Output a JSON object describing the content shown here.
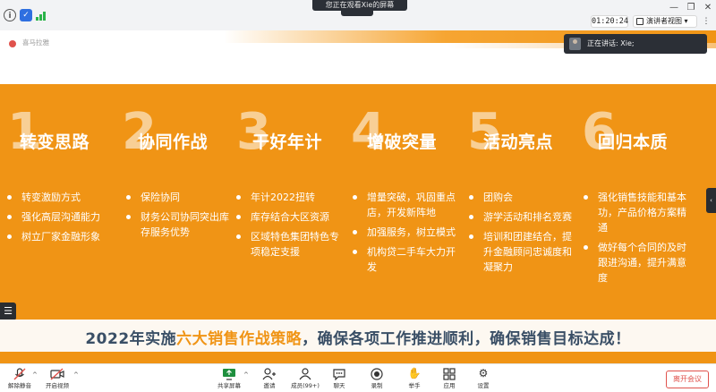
{
  "window": {
    "share_banner": "您正在观看Xie的屏幕",
    "timer": "01:20:24",
    "presenter_view_label": "演讲者视图",
    "colors": {
      "accent": "#2f6fe0",
      "signal": "#2cb34a",
      "danger": "#e0524c"
    }
  },
  "slide": {
    "tag": "喜马拉雅",
    "colors": {
      "orange": "#f09415",
      "tagline_text": "#3a4f66",
      "bullet_text": "#ffffff"
    },
    "columns": [
      {
        "number": "1",
        "title": "转变思路",
        "bullets": [
          "转变激励方式",
          "强化高层沟通能力",
          "树立厂家金融形象"
        ]
      },
      {
        "number": "2",
        "title": "协同作战",
        "bullets": [
          "保险协同",
          "财务公司协同突出库存服务优势"
        ]
      },
      {
        "number": "3",
        "title": "干好年计",
        "bullets": [
          "年计2022扭转",
          "库存结合大区资源",
          "区域特色集团特色专项稳定支援"
        ]
      },
      {
        "number": "4",
        "title": "增破突量",
        "bullets": [
          "增量突破，巩固重点店，开发新阵地",
          "加强服务，树立模式",
          "机构贷二手车大力开发"
        ]
      },
      {
        "number": "5",
        "title": "活动亮点",
        "bullets": [
          "团购会",
          "游学活动和排名竞赛",
          "培训和团建结合，提升金融顾问忠诚度和凝聚力"
        ]
      },
      {
        "number": "6",
        "title": "回归本质",
        "bullets": [
          "强化销售技能和基本功，产品价格方案精通",
          "做好每个合同的及时跟进沟通，提升满意度"
        ]
      }
    ],
    "tagline": {
      "prefix": "2022年实施",
      "highlight": "六大销售作战策略",
      "suffix": "，确保各项工作推进顺利，确保销售目标达成！"
    }
  },
  "speaking": {
    "text": "正在讲话: Xie;"
  },
  "toolbar": {
    "unmute_label": "解除静音",
    "video_label": "开启视频",
    "share_label": "共享屏幕",
    "invite_label": "邀请",
    "members_label": "成员(99+)",
    "chat_label": "聊天",
    "record_label": "录制",
    "raise_hand_label": "举手",
    "apps_label": "应用",
    "settings_label": "设置",
    "leave_label": "离开会议"
  }
}
